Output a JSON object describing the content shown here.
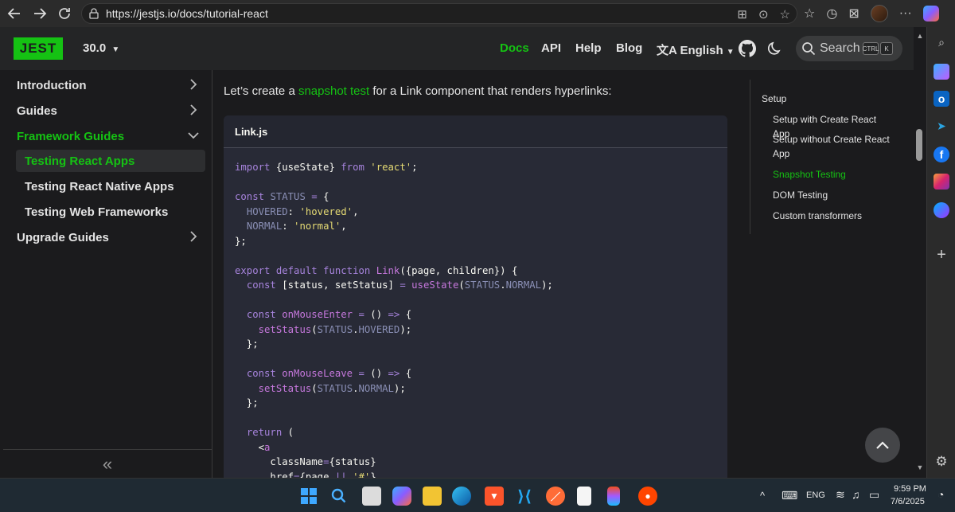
{
  "browser": {
    "url": "https://jestjs.io/docs/tutorial-react",
    "back_icon": "back-arrow-icon",
    "forward_icon": "forward-arrow-icon",
    "reload_icon": "reload-icon",
    "more_label": "···"
  },
  "site": {
    "logo": "JEST",
    "version": "30.0",
    "nav": {
      "docs": "Docs",
      "api": "API",
      "help": "Help",
      "blog": "Blog",
      "language": "English"
    },
    "search": {
      "placeholder": "Search",
      "kbd_ctrl": "CTRL",
      "kbd_k": "K"
    },
    "accent": "#15c213"
  },
  "sidebar": {
    "items": [
      {
        "label": "Introduction"
      },
      {
        "label": "Guides"
      },
      {
        "label": "Framework Guides"
      },
      {
        "label": "Testing React Apps"
      },
      {
        "label": "Testing React Native Apps"
      },
      {
        "label": "Testing Web Frameworks"
      },
      {
        "label": "Upgrade Guides"
      }
    ],
    "collapse_label": "«"
  },
  "content": {
    "intro_before": "Let’s create a ",
    "intro_link": "snapshot test",
    "intro_after": " for a Link component that renders hyperlinks:",
    "code_title": "Link.js"
  },
  "toc": {
    "items": [
      {
        "label": "Setup"
      },
      {
        "label": "Setup with Create React App"
      },
      {
        "label": "Setup without Create React App"
      },
      {
        "label": "Snapshot Testing"
      },
      {
        "label": "DOM Testing"
      },
      {
        "label": "Custom transformers"
      }
    ]
  },
  "taskbar": {
    "language": "ENG",
    "time": "9:59 PM",
    "date": "7/6/2025"
  }
}
